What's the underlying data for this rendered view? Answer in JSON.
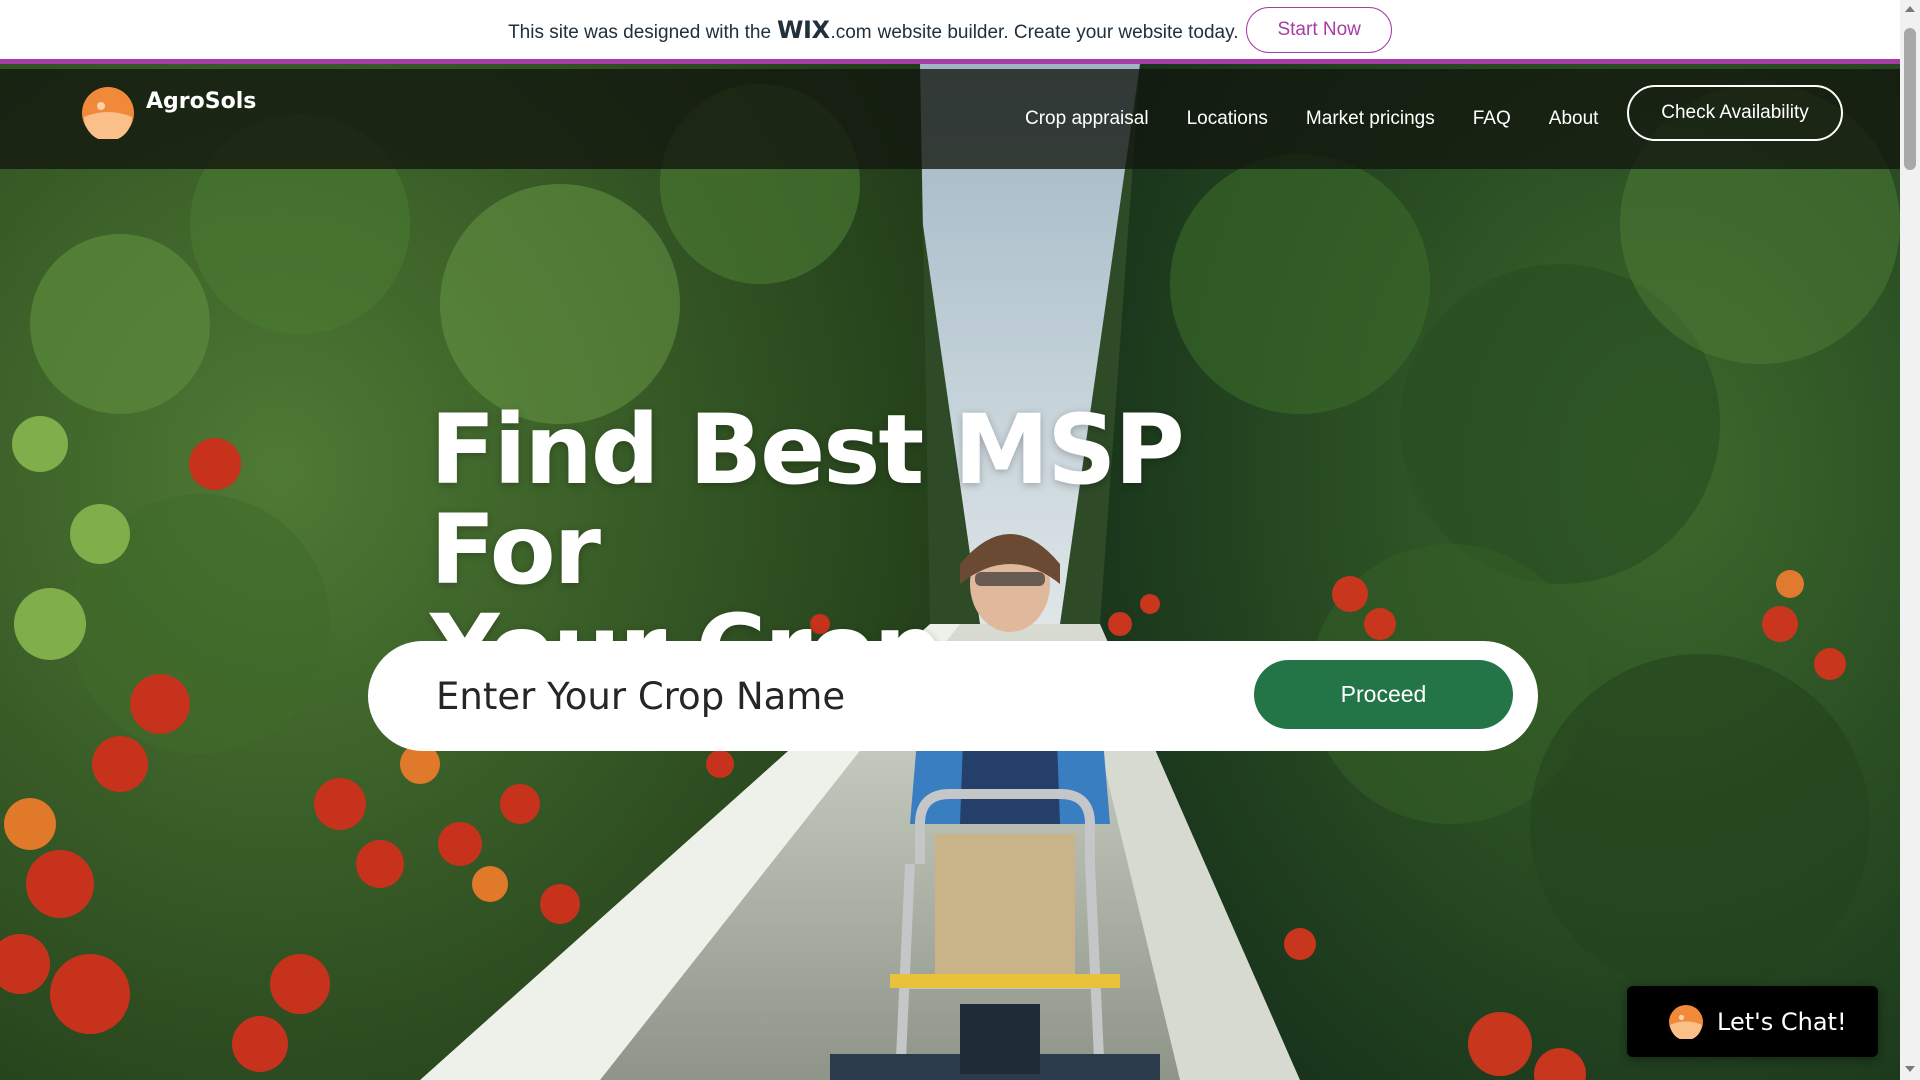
{
  "wix_banner": {
    "text_before": "This site was designed with the",
    "logo": "WIX",
    "dotcom": ".com",
    "text_after": "website builder. Create your website today.",
    "cta": "Start Now",
    "accent_color": "#a83ca6"
  },
  "header": {
    "brand_name": "AgroSols",
    "logo_icon": "sun-logo-icon",
    "nav": [
      {
        "label": "Crop appraisal"
      },
      {
        "label": "Locations"
      },
      {
        "label": "Market pricings"
      },
      {
        "label": "FAQ"
      },
      {
        "label": "About"
      }
    ],
    "cta": "Check Availability"
  },
  "hero": {
    "headline_line1": "Find Best MSP For",
    "headline_line2": "Your Crop",
    "background": "greenhouse-tomato-rows-photo"
  },
  "search": {
    "placeholder": "Enter Your Crop Name",
    "value": "",
    "button_label": "Proceed",
    "button_color": "#237548"
  },
  "chat": {
    "label": "Let's Chat!",
    "icon": "sun-logo-icon"
  },
  "colors": {
    "brand_orange": "#f08a3a",
    "brand_orange_light": "#fbbf8a",
    "header_bg": "#12160e"
  }
}
